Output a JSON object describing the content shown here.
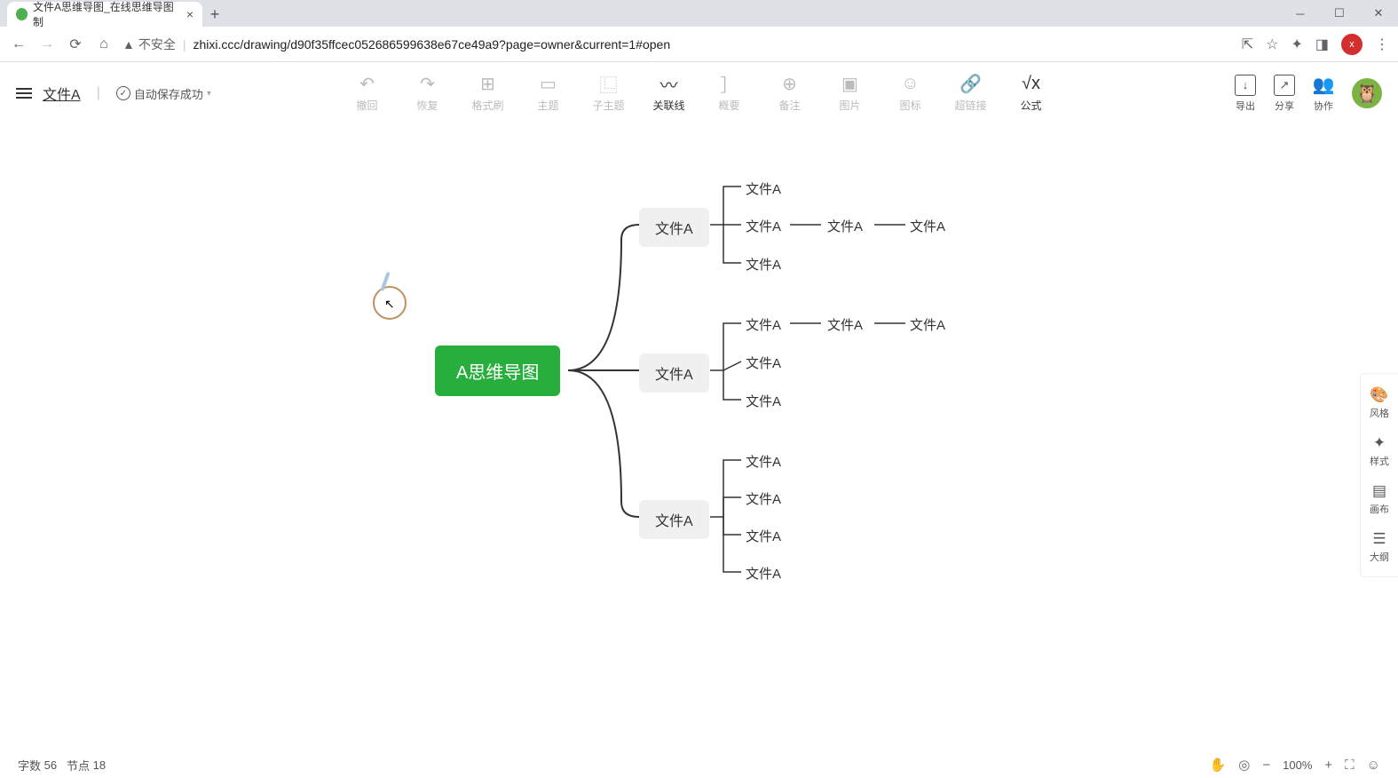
{
  "browser": {
    "tab_title": "文件A思维导图_在线思维导图制",
    "url_warn": "不安全",
    "url": "zhixi.ccc/drawing/d90f35ffcec052686599638e67ce49a9?page=owner&current=1#open"
  },
  "header": {
    "file_name": "文件A",
    "save_status": "自动保存成功"
  },
  "toolbar": {
    "undo": "撤回",
    "redo": "恢复",
    "format": "格式刷",
    "topic": "主题",
    "subtopic": "子主题",
    "relation": "关联线",
    "summary": "概要",
    "note": "备注",
    "image": "图片",
    "icon": "图标",
    "link": "超链接",
    "formula": "公式"
  },
  "actions": {
    "export": "导出",
    "share": "分享",
    "collaborate": "协作"
  },
  "sidebar": {
    "style": "风格",
    "format": "样式",
    "canvas": "画布",
    "outline": "大纲"
  },
  "mindmap": {
    "root": "A思维导图",
    "main1": "文件A",
    "main2": "文件A",
    "main3": "文件A",
    "c1_1": "文件A",
    "c1_2": "文件A",
    "c1_3": "文件A",
    "c1_2_1": "文件A",
    "c1_2_2": "文件A",
    "c2_1": "文件A",
    "c2_2": "文件A",
    "c2_3": "文件A",
    "c2_1_1": "文件A",
    "c2_1_2": "文件A",
    "c3_1": "文件A",
    "c3_2": "文件A",
    "c3_3": "文件A",
    "c3_4": "文件A"
  },
  "footer": {
    "word_label": "字数",
    "word_count": "56",
    "node_label": "节点",
    "node_count": "18",
    "zoom": "100%"
  }
}
